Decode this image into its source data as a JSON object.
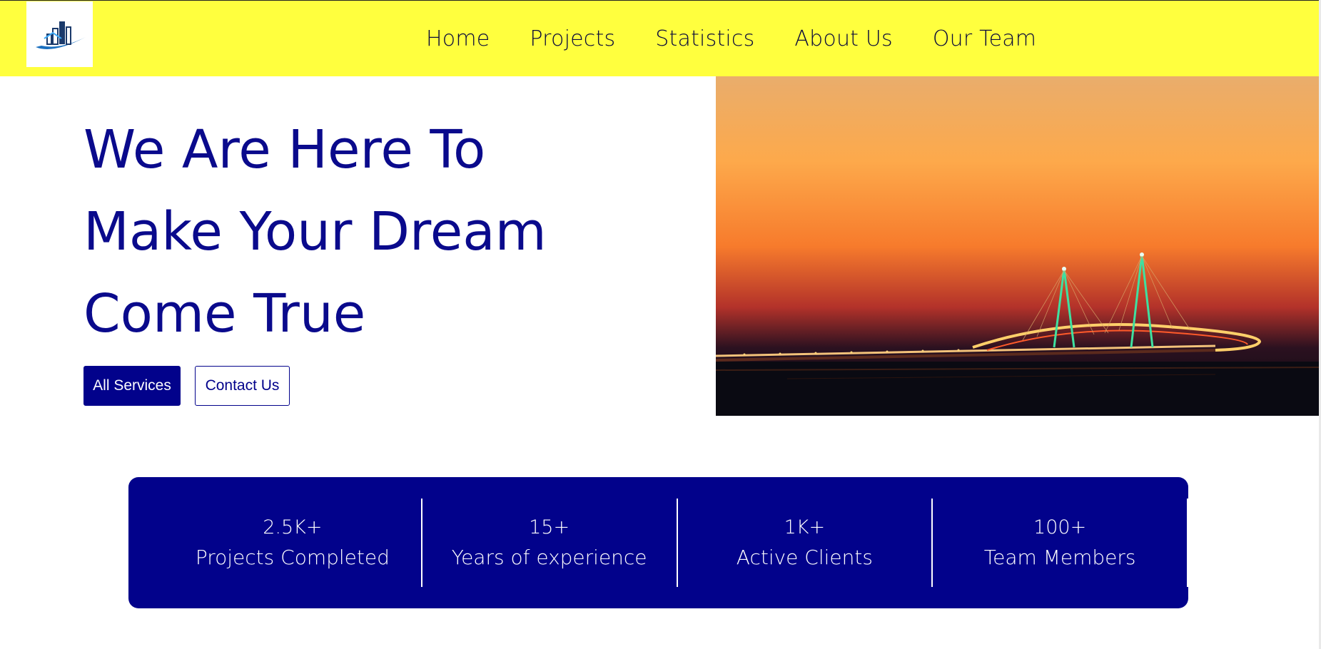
{
  "colors": {
    "header_bg": "#ffff3e",
    "brand_blue": "#02028b",
    "heading_blue": "#0a0a8c",
    "nav_text": "#0a0a3c",
    "white": "#ffffff"
  },
  "header": {
    "logo_icon": "building-logo-icon",
    "nav": [
      {
        "label": "Home"
      },
      {
        "label": "Projects"
      },
      {
        "label": "Statistics"
      },
      {
        "label": "About Us"
      },
      {
        "label": "Our Team"
      }
    ]
  },
  "hero": {
    "title_lines": [
      "We Are Here To",
      "Make Your Dream",
      "Come True"
    ],
    "primary_button": "All Services",
    "secondary_button": "Contact Us",
    "image_icon": "bridge-sunset-image"
  },
  "stats": [
    {
      "value": "2.5K+",
      "label": "Projects Completed"
    },
    {
      "value": "15+",
      "label": "Years of experience"
    },
    {
      "value": "1K+",
      "label": "Active Clients"
    },
    {
      "value": "100+",
      "label": "Team Members"
    }
  ]
}
